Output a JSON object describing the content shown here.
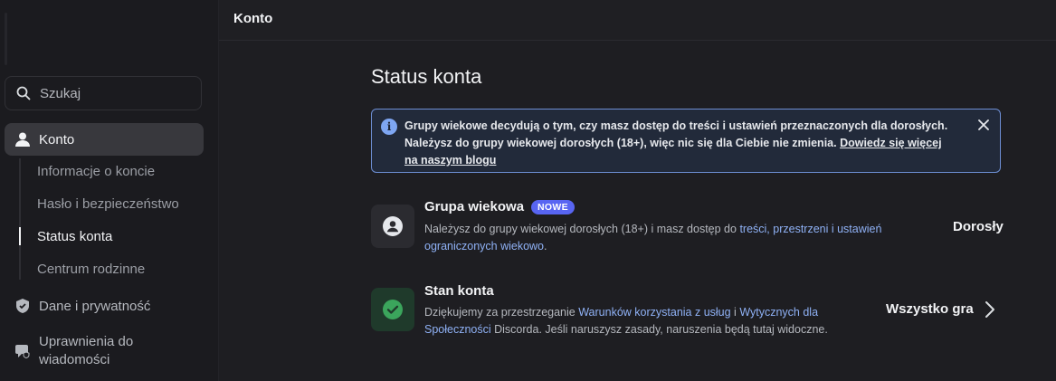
{
  "topbar": {
    "title": "Konto"
  },
  "search": {
    "placeholder": "Szukaj"
  },
  "sidebar": {
    "konto": "Konto",
    "sub": [
      "Informacje o koncie",
      "Hasło i bezpieczeństwo",
      "Status konta",
      "Centrum rodzinne"
    ],
    "dane": "Dane i prywatność",
    "uprawnienia_1": "Uprawnienia do",
    "uprawnienia_2": "wiadomości"
  },
  "main": {
    "title": "Status konta",
    "notice": {
      "line1": "Grupy wiekowe decydują o tym, czy masz dostęp do treści i ustawień przeznaczonych dla dorosłych.",
      "line2": "Należysz do grupy wiekowej dorosłych (18+), więc nic się dla Ciebie nie zmienia. ",
      "link": "Dowiedz się więcej na naszym blogu"
    },
    "age_group": {
      "title": "Grupa wiekowa",
      "badge": "NOWE",
      "desc_a": "Należysz do grupy wiekowej dorosłych (18+) i masz dostęp do ",
      "desc_link": "treści, przestrzeni i ustawień ograniczonych wiekowo",
      "desc_b": ".",
      "value": "Dorosły"
    },
    "account_state": {
      "title": "Stan konta",
      "desc_a": "Dziękujemy za przestrzeganie ",
      "link1": "Warunków korzystania z usług",
      "desc_mid": " i ",
      "link2": "Wytycznych dla Społeczności",
      "desc_b": " Discorda. Jeśli naruszysz zasady, naruszenia będą tutaj widoczne.",
      "value": "Wszystko gra"
    }
  },
  "colors": {
    "accent": "#5865f2",
    "link": "#8fb1f5",
    "success": "#3ba55c",
    "notice_border": "#6d8ed3"
  }
}
